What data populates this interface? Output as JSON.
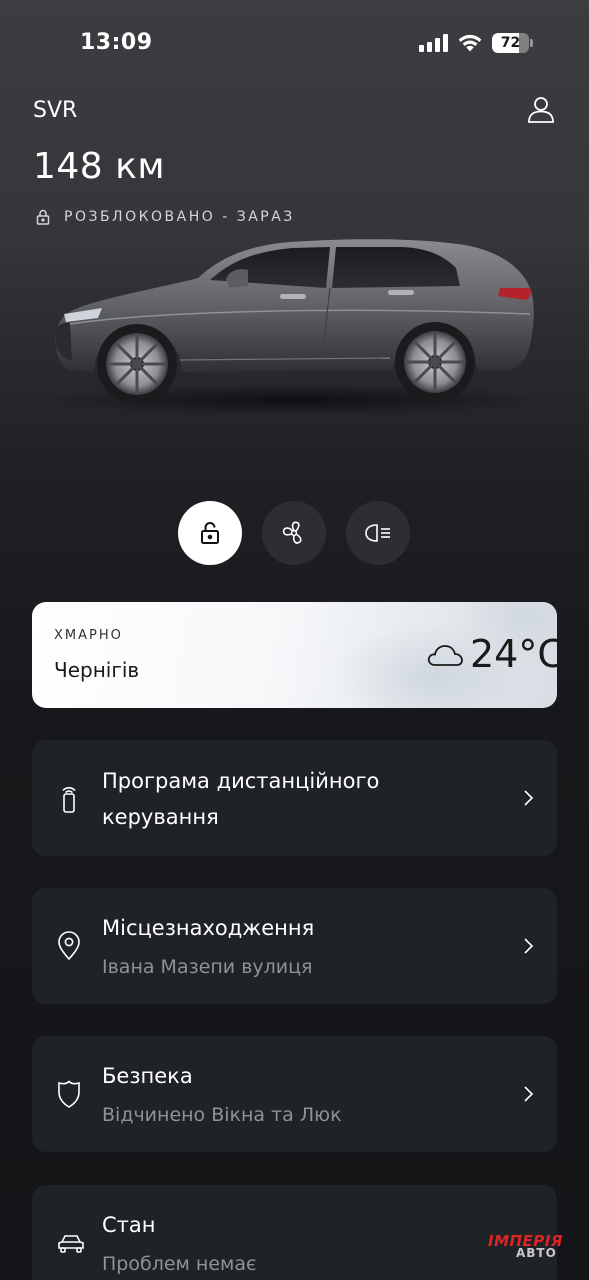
{
  "status_bar": {
    "time": "13:09",
    "battery_level": "72",
    "icons": [
      "cellular-signal-icon",
      "wifi-icon",
      "battery-icon"
    ]
  },
  "header": {
    "car_name": "SVR",
    "range": "148 км",
    "lock_status": "РОЗБЛОКОВАНО - ЗАРАЗ",
    "profile_icon": "user-icon"
  },
  "quick_controls": [
    {
      "icon": "lock-icon",
      "active": true
    },
    {
      "icon": "fan-icon",
      "active": false
    },
    {
      "icon": "headlight-icon",
      "active": false
    }
  ],
  "weather": {
    "condition": "ХМАРНО",
    "city": "Чернігів",
    "temperature": "24°C",
    "icon": "cloud-icon"
  },
  "menu": [
    {
      "icon": "remote-key-icon",
      "title_line1": "Програма дистанційного",
      "title_line2": "керування"
    },
    {
      "icon": "location-pin-icon",
      "title": "Місцезнаходження",
      "subtitle": "Івана Мазепи вулиця"
    },
    {
      "icon": "shield-icon",
      "title": "Безпека",
      "subtitle": "Відчинено Вікна та Люк"
    },
    {
      "icon": "car-icon",
      "title": "Стан",
      "subtitle": "Проблем немає"
    }
  ],
  "watermark": {
    "text": "ІМПЕРІЯ",
    "sub": "АВТО"
  },
  "colors": {
    "background_top": "#3b3d41",
    "background_bottom": "#141518",
    "card": "#1f2227",
    "subtitle": "#8e9297",
    "active_control": "#ffffff"
  }
}
